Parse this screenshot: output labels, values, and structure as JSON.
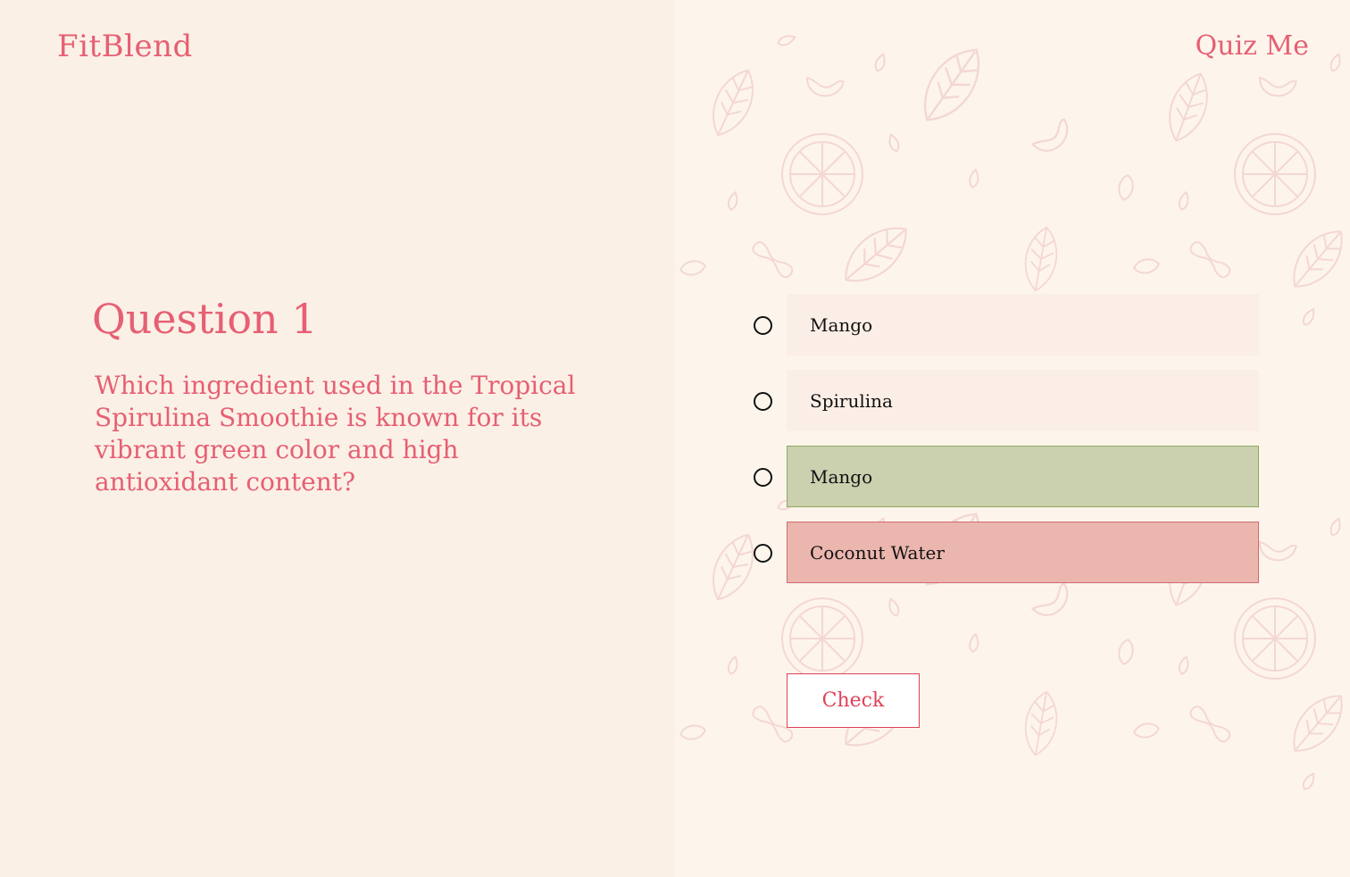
{
  "header": {
    "logo": "FitBlend",
    "nav_link": "Quiz Me"
  },
  "question": {
    "title": "Question 1",
    "text": "Which ingredient used in the Tropical Spirulina Smoothie is known for its vibrant green color and high antioxidant content?"
  },
  "options": [
    {
      "label": "Mango",
      "state": "default"
    },
    {
      "label": "Spirulina",
      "state": "default"
    },
    {
      "label": "Mango",
      "state": "correct"
    },
    {
      "label": "Coconut Water",
      "state": "wrong"
    }
  ],
  "actions": {
    "check_label": "Check"
  },
  "colors": {
    "brand": "#e65f73",
    "left_bg": "#fbf0e6",
    "right_bg": "#fdf5eb",
    "option_default": "#fbeee6",
    "option_correct": "#cbd0af",
    "option_wrong": "#ebb6ae",
    "pattern_stroke": "#f4d7d2"
  },
  "decoration": {
    "pattern_icons": [
      "leaf-icon",
      "citrus-slice-icon",
      "cashew-icon",
      "almond-icon",
      "peanut-icon",
      "seed-icon",
      "strawberry-icon"
    ]
  }
}
